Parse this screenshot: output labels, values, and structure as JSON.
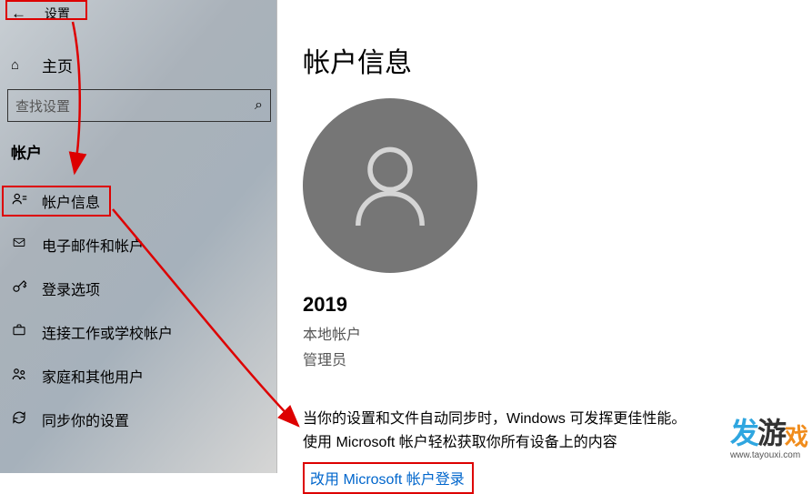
{
  "header": {
    "settings_label": "设置",
    "home_label": "主页"
  },
  "search": {
    "placeholder": "查找设置"
  },
  "sidebar": {
    "section": "帐户",
    "items": [
      {
        "icon": "person-icon",
        "label": "帐户信息"
      },
      {
        "icon": "mail-icon",
        "label": "电子邮件和帐户"
      },
      {
        "icon": "key-icon",
        "label": "登录选项"
      },
      {
        "icon": "briefcase-icon",
        "label": "连接工作或学校帐户"
      },
      {
        "icon": "family-icon",
        "label": "家庭和其他用户"
      },
      {
        "icon": "sync-icon",
        "label": "同步你的设置"
      }
    ]
  },
  "main": {
    "title": "帐户信息",
    "username": "2019",
    "account_type": "本地帐户",
    "account_role": "管理员",
    "sync_line1": "当你的设置和文件自动同步时，Windows 可发挥更佳性能。",
    "sync_line2": "使用 Microsoft 帐户轻松获取你所有设备上的内容",
    "ms_link": "改用 Microsoft 帐户登录"
  },
  "logo": {
    "brand": "发游戏",
    "url": "www.tayouxi.com"
  }
}
